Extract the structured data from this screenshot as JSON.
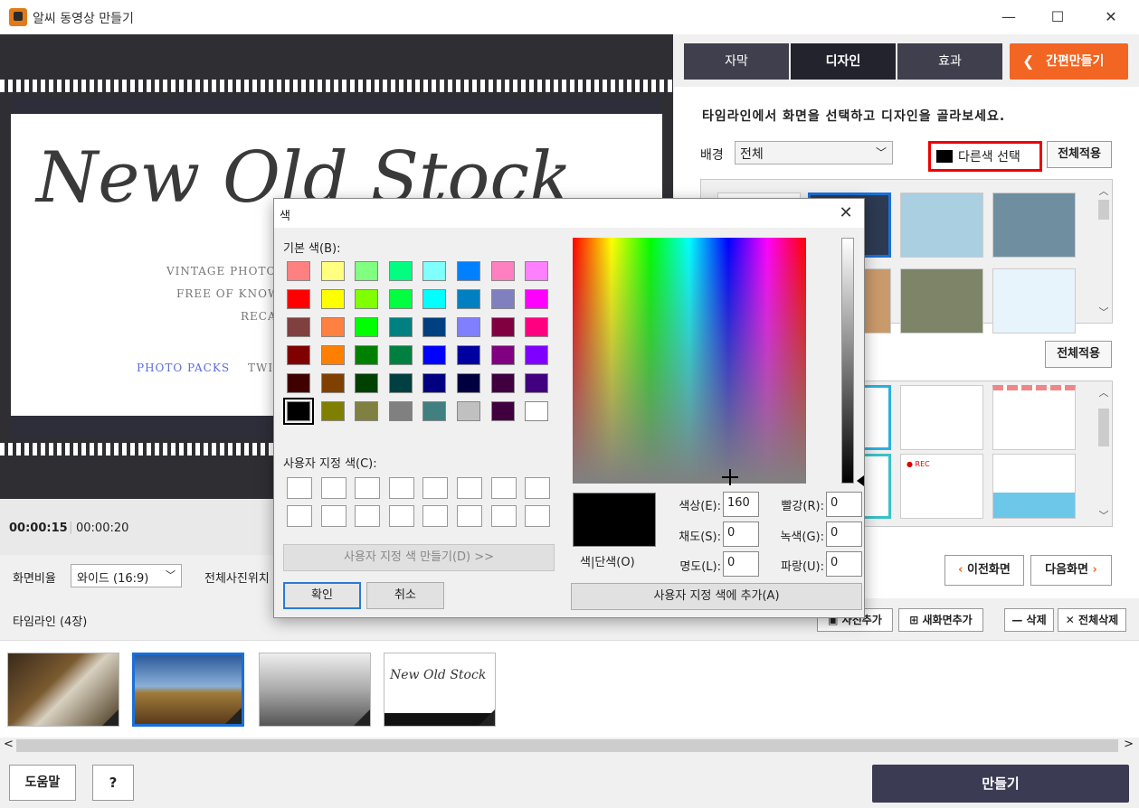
{
  "window": {
    "title": "알씨 동영상 만들기",
    "minimize": "—",
    "maximize": "☐",
    "close": "✕"
  },
  "slide": {
    "heading": "New Old Stock",
    "line1": "VINTAGE PHOTOS",
    "line2": "FREE OF KNOW",
    "line3": "RECA",
    "link1": "PHOTO PACKS",
    "link2": "TWI"
  },
  "playback": {
    "current_time": "00:00:15",
    "separator": "|",
    "total_time": "00:00:20"
  },
  "ratio": {
    "label": "화면비율",
    "value": "와이드 (16:9)",
    "photo_position_label": "전체사진위치"
  },
  "tabs": [
    {
      "label": "자막",
      "active": false
    },
    {
      "label": "디자인",
      "active": true
    },
    {
      "label": "효과",
      "active": false
    }
  ],
  "quick_button": "간편만들기",
  "design": {
    "instruction": "타임라인에서 화면을 선택하고 디자인을 골라보세요.",
    "background_label": "배경",
    "background_value": "전체",
    "other_color_label": "다른색 선택",
    "apply_all_1": "전체적용",
    "apply_all_2": "전체적용",
    "prev_screen": "이전화면",
    "next_screen": "다음화면",
    "frame_rec_text": "● REC"
  },
  "timeline": {
    "title": "타임라인 (4장)",
    "add_photo": "사진추가",
    "add_screen": "새화면추가",
    "delete": "삭제",
    "delete_all": "전체삭제",
    "thumb4_text": "New Old Stock",
    "scroll_left": "<",
    "scroll_right": ">"
  },
  "bottom": {
    "help": "도움말",
    "question": "?",
    "make": "만들기"
  },
  "color_dialog": {
    "title": "색",
    "close": "✕",
    "basic_colors_label": "기본 색(B):",
    "custom_colors_label": "사용자 지정 색(C):",
    "define_custom": "사용자 지정 색 만들기(D) >>",
    "ok": "확인",
    "cancel": "취소",
    "preview_label": "색|단색(O)",
    "hue_label": "색상(E):",
    "hue_value": "160",
    "sat_label": "채도(S):",
    "sat_value": "0",
    "lum_label": "명도(L):",
    "lum_value": "0",
    "red_label": "빨강(R):",
    "red_value": "0",
    "green_label": "녹색(G):",
    "green_value": "0",
    "blue_label": "파랑(U):",
    "blue_value": "0",
    "add_to_custom": "사용자 지정 색에 추가(A)",
    "basic_colors": [
      "#ff8080",
      "#ffff80",
      "#80ff80",
      "#00ff80",
      "#80ffff",
      "#0080ff",
      "#ff80c0",
      "#ff80ff",
      "#ff0000",
      "#ffff00",
      "#80ff00",
      "#00ff40",
      "#00ffff",
      "#0080c0",
      "#8080c0",
      "#ff00ff",
      "#804040",
      "#ff8040",
      "#00ff00",
      "#008080",
      "#004080",
      "#8080ff",
      "#800040",
      "#ff0080",
      "#800000",
      "#ff8000",
      "#008000",
      "#008040",
      "#0000ff",
      "#0000a0",
      "#800080",
      "#8000ff",
      "#400000",
      "#804000",
      "#004000",
      "#004040",
      "#000080",
      "#000040",
      "#400040",
      "#400080",
      "#000000",
      "#808000",
      "#808040",
      "#808080",
      "#408080",
      "#c0c0c0",
      "#400040",
      "#ffffff"
    ],
    "selected_index": 40
  }
}
